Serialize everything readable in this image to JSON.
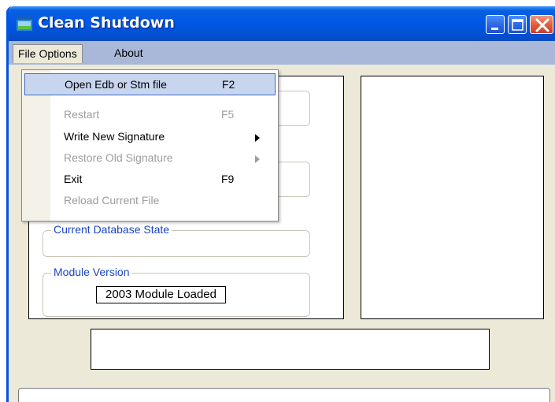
{
  "window": {
    "title": "Clean Shutdown",
    "icon": "app-window-icon",
    "controls": [
      "minimize-icon",
      "maximize-icon",
      "close-icon"
    ]
  },
  "menubar": {
    "items": [
      {
        "label": "File Options",
        "open": true
      },
      {
        "label": "About",
        "open": false
      }
    ]
  },
  "file_menu": {
    "items": [
      {
        "label": "Open Edb or Stm file",
        "shortcut": "F2",
        "enabled": true,
        "selected": true,
        "submenu": false
      },
      {
        "label": "Restart",
        "shortcut": "F5",
        "enabled": false,
        "selected": false,
        "submenu": false
      },
      {
        "label": "Write New Signature",
        "shortcut": "",
        "enabled": true,
        "selected": false,
        "submenu": true
      },
      {
        "label": "Restore Old Signature",
        "shortcut": "",
        "enabled": false,
        "selected": false,
        "submenu": true
      },
      {
        "label": "Exit",
        "shortcut": "F9",
        "enabled": true,
        "selected": false,
        "submenu": false
      },
      {
        "label": "Reload Current File",
        "shortcut": "",
        "enabled": false,
        "selected": false,
        "submenu": false
      }
    ]
  },
  "groups": {
    "database_state": {
      "label": "Current Database State",
      "value": ""
    },
    "module_version": {
      "label": "Module Version",
      "value": "2003 Module Loaded"
    }
  },
  "colors": {
    "titlebar": "#0058e6",
    "menubar": "#a9b8d9",
    "group_label": "#1c46c4",
    "disabled_text": "#9d9d9d",
    "selection": "#c7d5ef"
  }
}
